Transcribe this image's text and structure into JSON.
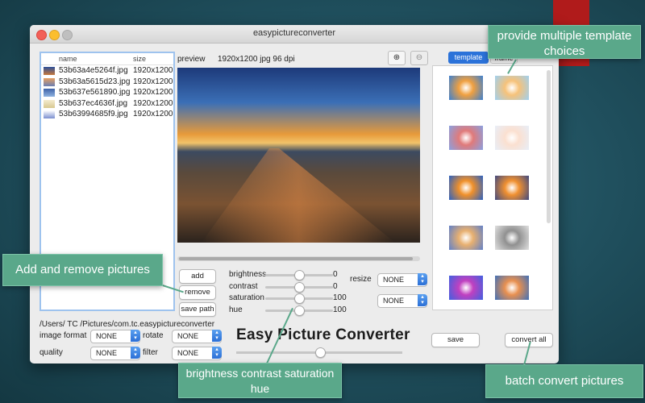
{
  "window": {
    "title": "easypictureconverter"
  },
  "file_list": {
    "headers": {
      "name": "name",
      "size": "size"
    },
    "rows": [
      {
        "name": "53b63a4e5264f.jpg",
        "size": "1920x1200",
        "thumb_color": "#c9783a"
      },
      {
        "name": "53b63a5615d23.jpg",
        "size": "1920x1200",
        "thumb_color": "#6a7fb4"
      },
      {
        "name": "53b637e561890.jpg",
        "size": "1920x1200",
        "thumb_color": "#3e62a8"
      },
      {
        "name": "53b637ec4636f.jpg",
        "size": "1920x1200",
        "thumb_color": "#e8d9a8"
      },
      {
        "name": "53b63994685f9.jpg",
        "size": "1920x1200",
        "thumb_color": "#7b8fd0"
      }
    ]
  },
  "preview": {
    "label": "preview",
    "info": "1920x1200 jpg 96 dpi",
    "zoom_in": "⊕",
    "zoom_out": "⊖"
  },
  "buttons": {
    "add": "add",
    "remove": "remove",
    "save_path": "save path",
    "save": "save",
    "convert_all": "convert all"
  },
  "adjust": {
    "brightness": {
      "label": "brightness",
      "value": "0",
      "level": 0.5
    },
    "contrast": {
      "label": "contrast",
      "value": "0",
      "level": 0.5
    },
    "saturation": {
      "label": "saturation",
      "value": "100",
      "level": 0.5
    },
    "hue": {
      "label": "hue",
      "value": "100",
      "level": 0.5
    }
  },
  "resize": {
    "label": "resize",
    "value": "NONE",
    "value2": "NONE"
  },
  "path": "/Users/  TC  /Pictures/com.tc.easypictureconverter",
  "options": {
    "image_format": {
      "label": "image format",
      "value": "NONE"
    },
    "rotate": {
      "label": "rotate",
      "value": "NONE"
    },
    "quality": {
      "label": "quality",
      "value": "NONE"
    },
    "filter": {
      "label": "filter",
      "value": "NONE"
    }
  },
  "app_title": "Easy Picture Converter",
  "tabs": {
    "active": "template",
    "other": "frame"
  },
  "templates": [
    {
      "c1": "#f0a040",
      "c2": "#3a7fd0"
    },
    {
      "c1": "#f6c27a",
      "c2": "#9fd0f0"
    },
    {
      "c1": "#e07a7a",
      "c2": "#8aa0e0"
    },
    {
      "c1": "#fbe0d0",
      "c2": "#e8eef8"
    },
    {
      "c1": "#f0902a",
      "c2": "#2a60c0"
    },
    {
      "c1": "#f09030",
      "c2": "#404a80"
    },
    {
      "c1": "#e8b070",
      "c2": "#6080c8"
    },
    {
      "c1": "#909090",
      "c2": "#e0e0e0"
    },
    {
      "c1": "#c040c0",
      "c2": "#4060e0"
    },
    {
      "c1": "#e89050",
      "c2": "#4070b8"
    }
  ],
  "callouts": {
    "templates": "provide multiple template choices",
    "add_remove": "Add and remove pictures",
    "adjust": "brightness contrast saturation hue",
    "batch": "batch convert pictures"
  },
  "colors": {
    "accent_blue": "#2b6fd6",
    "callout_green": "#5aa88a",
    "ribbon_red": "#b01b1b"
  }
}
